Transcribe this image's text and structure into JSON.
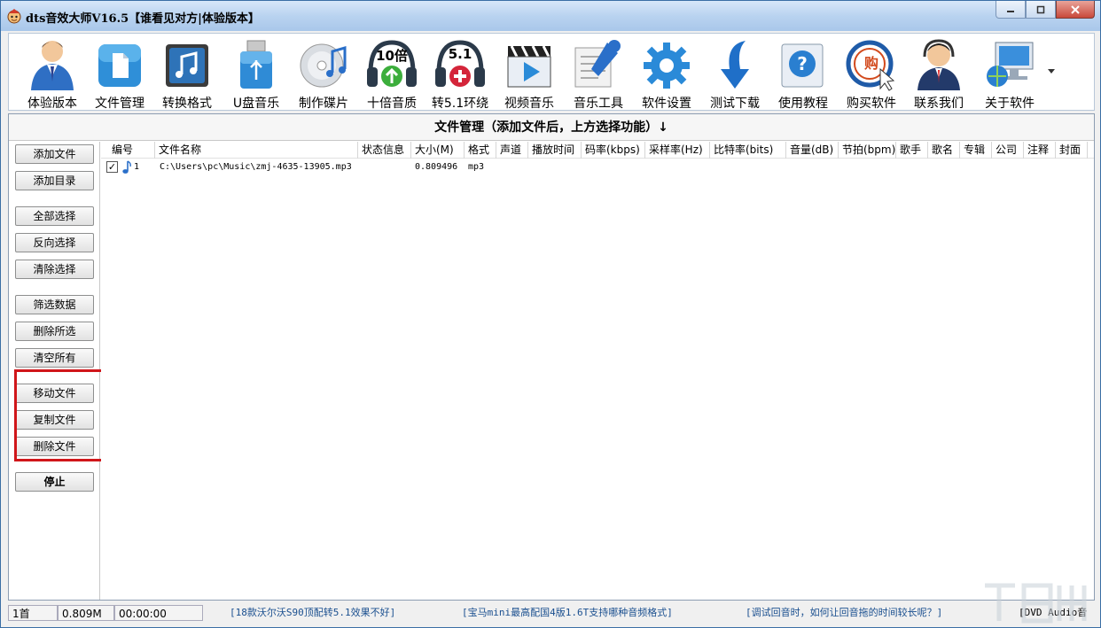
{
  "window": {
    "title": "dts音效大师V16.5【谁看见对方|体验版本】",
    "controls": {
      "minimize": "▭",
      "restore": "▢",
      "close": "✕"
    }
  },
  "toolbar": {
    "items": [
      {
        "label": "体验版本",
        "icon": "user-icon"
      },
      {
        "label": "文件管理",
        "icon": "file-icon"
      },
      {
        "label": "转换格式",
        "icon": "music-convert-icon"
      },
      {
        "label": "U盘音乐",
        "icon": "usb-icon"
      },
      {
        "label": "制作碟片",
        "icon": "disc-icon"
      },
      {
        "label": "十倍音质",
        "icon": "headphones-10x-icon",
        "badge": "10倍"
      },
      {
        "label": "转5.1环绕",
        "icon": "headphones-51-icon",
        "badge": "5.1"
      },
      {
        "label": "视频音乐",
        "icon": "video-icon"
      },
      {
        "label": "音乐工具",
        "icon": "tools-icon"
      },
      {
        "label": "软件设置",
        "icon": "gear-icon"
      },
      {
        "label": "测试下载",
        "icon": "download-icon"
      },
      {
        "label": "使用教程",
        "icon": "help-icon"
      },
      {
        "label": "购买软件",
        "icon": "buy-icon",
        "badge": "购"
      },
      {
        "label": "联系我们",
        "icon": "support-icon"
      },
      {
        "label": "关于软件",
        "icon": "computer-icon"
      }
    ]
  },
  "section": {
    "title": "文件管理（添加文件后，上方选择功能）↓"
  },
  "sidebar": {
    "buttons": [
      {
        "label": "添加文件"
      },
      {
        "label": "添加目录"
      },
      {
        "label": "全部选择"
      },
      {
        "label": "反向选择"
      },
      {
        "label": "清除选择"
      },
      {
        "label": "筛选数据"
      },
      {
        "label": "删除所选"
      },
      {
        "label": "清空所有"
      },
      {
        "label": "移动文件"
      },
      {
        "label": "复制文件"
      },
      {
        "label": "删除文件"
      },
      {
        "label": "停止"
      }
    ]
  },
  "list": {
    "columns": [
      "编号",
      "文件名称",
      "状态信息",
      "大小(M)",
      "格式",
      "声道",
      "播放时间",
      "码率(kbps)",
      "采样率(Hz)",
      "比特率(bits)",
      "音量(dB)",
      "节拍(bpm)",
      "歌手",
      "歌名",
      "专辑",
      "公司",
      "注释",
      "封面"
    ],
    "rows": [
      {
        "checked": "✓",
        "index": "1",
        "filename": "C:\\Users\\pc\\Music\\zmj-4635-13905.mp3",
        "status": "",
        "size": "0.809496",
        "format": "mp3"
      }
    ]
  },
  "statusbar": {
    "count": "1首",
    "size": "0.809M",
    "time": "00:00:00",
    "link1": "[18款沃尔沃S90顶配转5.1效果不好]",
    "link2": "[宝马mini最高配国4版1.6T支持哪种音频格式]",
    "link3": "[调试回音时，如何让回音拖的时间较长呢？]",
    "link4": "[DVD Audio音"
  },
  "colors": {
    "accent": "#2a6fc9",
    "highlight_border": "#d0161a",
    "link": "#1a4f8f"
  }
}
